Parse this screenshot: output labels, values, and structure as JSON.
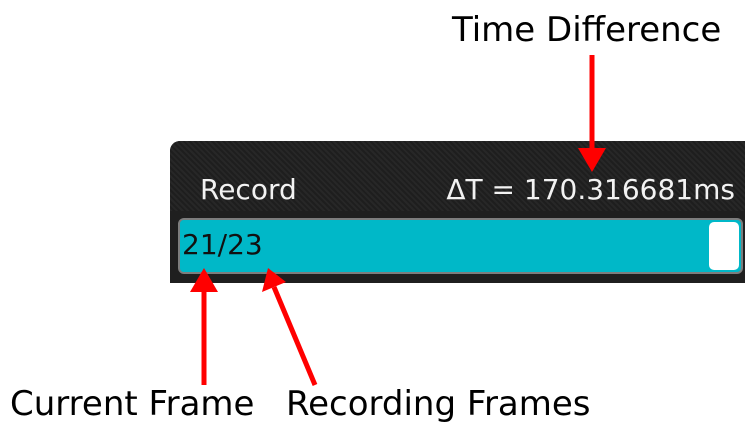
{
  "panel": {
    "label": "Record",
    "delta_time": "ΔT = 170.316681ms",
    "frame_counter": "21/23",
    "current_frame": 21,
    "total_frames": 23,
    "progress_fraction": 0.955
  },
  "annotations": {
    "time_difference": "Time Difference",
    "current_frame": "Current Frame",
    "recording_frames": "Recording Frames"
  },
  "colors": {
    "progress": "#00b8c8",
    "panel_bg": "#1f1f1f",
    "arrow": "#ff0000"
  }
}
